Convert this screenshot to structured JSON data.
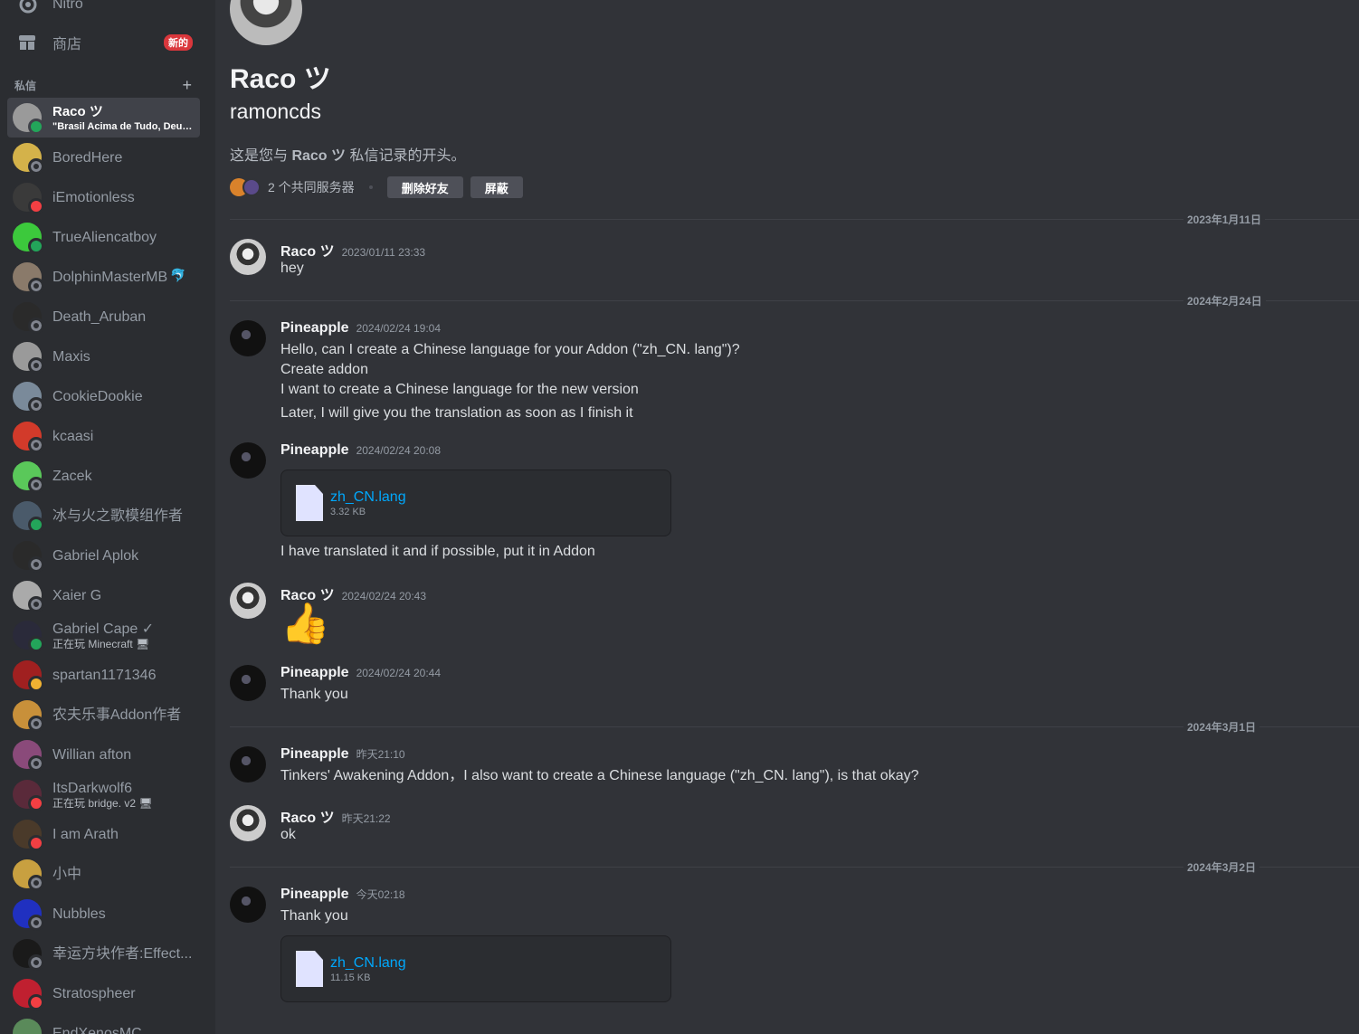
{
  "nav": {
    "nitro_label": "Nitro",
    "shop_label": "商店",
    "shop_badge": "新的"
  },
  "dm": {
    "header": "私信",
    "add": "+",
    "items": [
      {
        "name": "Raco ツ",
        "sub": "\"Brasil Acima de Tudo, Deus acima de todos\"",
        "status": "online",
        "color": "#9a9a9a",
        "active": true
      },
      {
        "name": "BoredHere",
        "sub": "",
        "status": "offline",
        "color": "#d4b24a"
      },
      {
        "name": "iEmotionless",
        "sub": "",
        "status": "dnd",
        "color": "#3a3a3a"
      },
      {
        "name": "TrueAliencatboy",
        "sub": "",
        "status": "online",
        "color": "#3cc93c"
      },
      {
        "name": "DolphinMasterMB",
        "sub": "",
        "status": "offline",
        "color": "#8a7a6a",
        "suffix": "🐬"
      },
      {
        "name": "Death_Aruban",
        "sub": "",
        "status": "offline",
        "color": "#2a2a2a"
      },
      {
        "name": "Maxis",
        "sub": "",
        "status": "offline",
        "color": "#9a9a9a"
      },
      {
        "name": "CookieDookie",
        "sub": "",
        "status": "offline",
        "color": "#7a8a9a"
      },
      {
        "name": "kcaasi",
        "sub": "",
        "status": "offline",
        "color": "#d23a2a"
      },
      {
        "name": "Zacek",
        "sub": "",
        "status": "offline",
        "color": "#5ac85a"
      },
      {
        "name": "冰与火之歌模组作者",
        "sub": "",
        "status": "online",
        "color": "#4a5a6a"
      },
      {
        "name": "Gabriel Aplok",
        "sub": "",
        "status": "offline",
        "color": "#2a2a2a"
      },
      {
        "name": "Xaier G",
        "sub": "",
        "status": "offline",
        "color": "#aaaaaa"
      },
      {
        "name": "Gabriel Cape ✓",
        "sub": "正在玩 Minecraft 🖥",
        "status": "online",
        "color": "#2a2a3a"
      },
      {
        "name": "spartan1171346",
        "sub": "",
        "status": "idle",
        "color": "#a02020"
      },
      {
        "name": "农夫乐事Addon作者",
        "sub": "",
        "status": "offline",
        "color": "#c8903a"
      },
      {
        "name": "Willian afton",
        "sub": "",
        "status": "offline",
        "color": "#8a4a7a"
      },
      {
        "name": "ItsDarkwolf6",
        "sub": "正在玩 bridge. v2 🖥",
        "status": "dnd",
        "color": "#5a2a3a"
      },
      {
        "name": "I am Arath",
        "sub": "",
        "status": "dnd",
        "color": "#4a3a2a"
      },
      {
        "name": "小中",
        "sub": "",
        "status": "offline",
        "color": "#c8a040"
      },
      {
        "name": "Nubbles",
        "sub": "",
        "status": "offline",
        "color": "#2030c0"
      },
      {
        "name": "幸运方块作者:Effect...",
        "sub": "",
        "status": "offline",
        "color": "#1a1a1a"
      },
      {
        "name": "Stratospheer",
        "sub": "",
        "status": "dnd",
        "color": "#c02030"
      },
      {
        "name": "EndXenosMC",
        "sub": "",
        "status": "offline",
        "color": "#5a8a5a"
      }
    ]
  },
  "profile": {
    "display_name": "Raco ツ",
    "username": "ramoncds",
    "intro_prefix": "这是您与 ",
    "intro_name": "Raco ツ",
    "intro_suffix": " 私信记录的开头。",
    "mutual_servers": "2 个共同服务器",
    "remove_friend": "删除好友",
    "block": "屏蔽"
  },
  "dividers": [
    "2023年1月11日",
    "2024年2月24日",
    "2024年3月1日",
    "2024年3月2日"
  ],
  "messages": [
    {
      "author": "Raco ツ",
      "time": "2023/01/11 23:33",
      "av": "raco",
      "lines": [
        "hey"
      ]
    },
    {
      "author": "Pineapple",
      "time": "2024/02/24 19:04",
      "av": "pine",
      "lines": [
        "Hello, can I create a Chinese language for your Addon (\"zh_CN. lang\")?",
        "Create addon",
        "I want to create a Chinese language for the new version",
        "Later, I will give you the translation as soon as I finish it"
      ]
    },
    {
      "author": "Pineapple",
      "time": "2024/02/24 20:08",
      "av": "pine",
      "file": {
        "name": "zh_CN.lang",
        "size": "3.32 KB"
      },
      "after": "I have translated it and if possible, put it in Addon"
    },
    {
      "author": "Raco ツ",
      "time": "2024/02/24 20:43",
      "av": "raco",
      "emoji": "👍"
    },
    {
      "author": "Pineapple",
      "time": "2024/02/24 20:44",
      "av": "pine",
      "lines": [
        "Thank you"
      ]
    },
    {
      "author": "Pineapple",
      "time": "昨天21:10",
      "av": "pine",
      "lines": [
        "Tinkers' Awakening Addon，I also want to create a Chinese language (\"zh_CN. lang\"), is that okay?"
      ]
    },
    {
      "author": "Raco ツ",
      "time": "昨天21:22",
      "av": "raco",
      "lines": [
        "ok"
      ]
    },
    {
      "author": "Pineapple",
      "time": "今天02:18",
      "av": "pine",
      "lines": [
        "Thank you"
      ],
      "file": {
        "name": "zh_CN.lang",
        "size": "11.15 KB"
      }
    }
  ]
}
